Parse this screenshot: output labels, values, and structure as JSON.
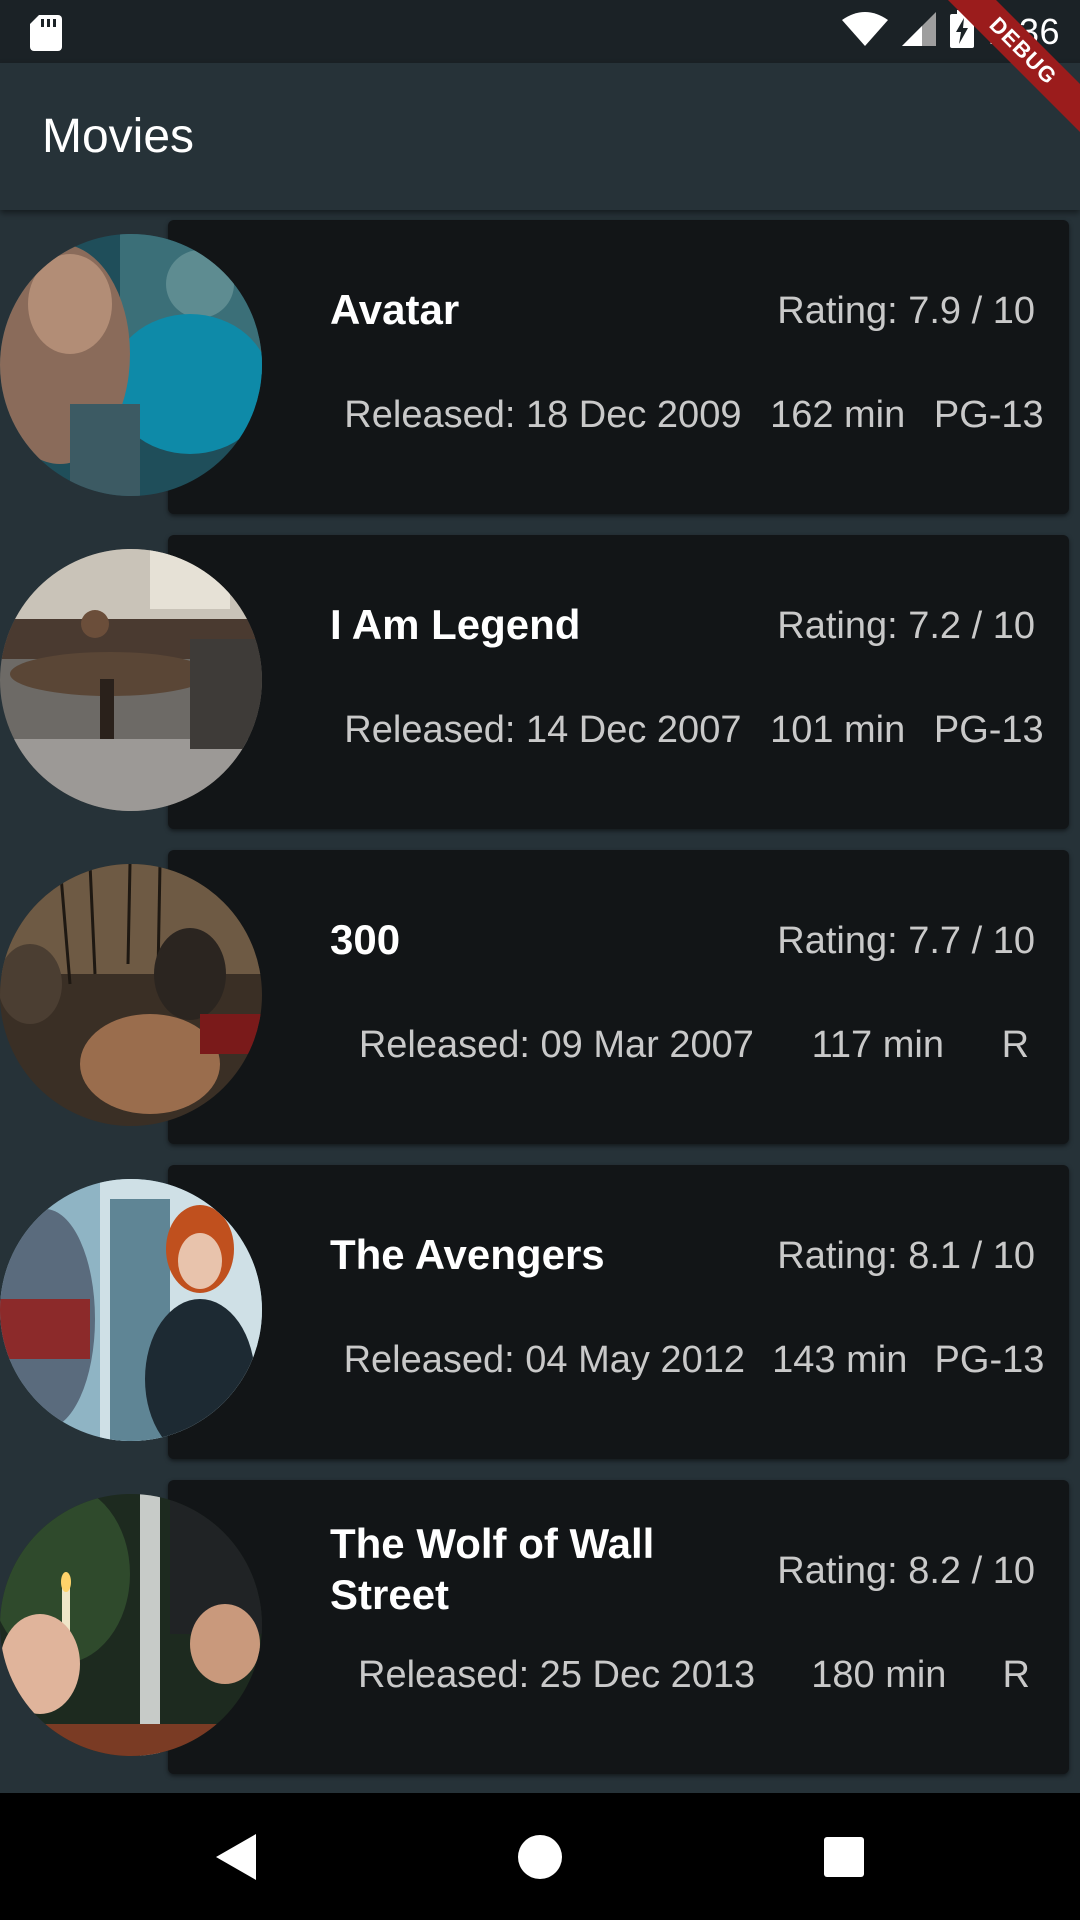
{
  "status_bar": {
    "time": "1:36",
    "icons": [
      "sd-card-icon",
      "wifi-icon",
      "signal-icon",
      "battery-charging-icon"
    ]
  },
  "debug_banner": "DEBUG",
  "app_bar": {
    "title": "Movies"
  },
  "movies": [
    {
      "title": "Avatar",
      "rating": "Rating: 7.9 / 10",
      "released": "Released: 18 Dec 2009",
      "runtime": "162 min",
      "rated": "PG-13"
    },
    {
      "title": "I Am Legend",
      "rating": "Rating: 7.2 / 10",
      "released": "Released: 14 Dec 2007",
      "runtime": "101 min",
      "rated": "PG-13"
    },
    {
      "title": "300",
      "rating": "Rating: 7.7 / 10",
      "released": "Released: 09 Mar 2007",
      "runtime": "117 min",
      "rated": "R"
    },
    {
      "title": "The Avengers",
      "rating": "Rating: 8.1 / 10",
      "released": "Released: 04 May 2012",
      "runtime": "143 min",
      "rated": "PG-13"
    },
    {
      "title": "The Wolf of Wall Street",
      "rating": "Rating: 8.2 / 10",
      "released": "Released: 25 Dec 2013",
      "runtime": "180 min",
      "rated": "R"
    }
  ],
  "nav_bar": {
    "buttons": [
      "back-icon",
      "home-icon",
      "recents-icon"
    ]
  },
  "colors": {
    "background": "#263238",
    "card": "#121517",
    "status_bar": "#1b2226",
    "debug_ribbon": "#9b1c1c",
    "secondary_text": "#c9c9c9"
  }
}
